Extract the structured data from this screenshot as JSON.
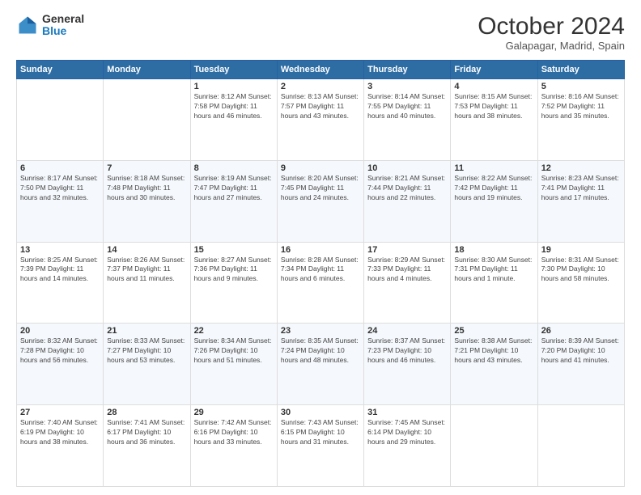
{
  "logo": {
    "general": "General",
    "blue": "Blue"
  },
  "header": {
    "month": "October 2024",
    "location": "Galapagar, Madrid, Spain"
  },
  "weekdays": [
    "Sunday",
    "Monday",
    "Tuesday",
    "Wednesday",
    "Thursday",
    "Friday",
    "Saturday"
  ],
  "weeks": [
    [
      {
        "day": "",
        "info": ""
      },
      {
        "day": "",
        "info": ""
      },
      {
        "day": "1",
        "info": "Sunrise: 8:12 AM\nSunset: 7:58 PM\nDaylight: 11 hours and 46 minutes."
      },
      {
        "day": "2",
        "info": "Sunrise: 8:13 AM\nSunset: 7:57 PM\nDaylight: 11 hours and 43 minutes."
      },
      {
        "day": "3",
        "info": "Sunrise: 8:14 AM\nSunset: 7:55 PM\nDaylight: 11 hours and 40 minutes."
      },
      {
        "day": "4",
        "info": "Sunrise: 8:15 AM\nSunset: 7:53 PM\nDaylight: 11 hours and 38 minutes."
      },
      {
        "day": "5",
        "info": "Sunrise: 8:16 AM\nSunset: 7:52 PM\nDaylight: 11 hours and 35 minutes."
      }
    ],
    [
      {
        "day": "6",
        "info": "Sunrise: 8:17 AM\nSunset: 7:50 PM\nDaylight: 11 hours and 32 minutes."
      },
      {
        "day": "7",
        "info": "Sunrise: 8:18 AM\nSunset: 7:48 PM\nDaylight: 11 hours and 30 minutes."
      },
      {
        "day": "8",
        "info": "Sunrise: 8:19 AM\nSunset: 7:47 PM\nDaylight: 11 hours and 27 minutes."
      },
      {
        "day": "9",
        "info": "Sunrise: 8:20 AM\nSunset: 7:45 PM\nDaylight: 11 hours and 24 minutes."
      },
      {
        "day": "10",
        "info": "Sunrise: 8:21 AM\nSunset: 7:44 PM\nDaylight: 11 hours and 22 minutes."
      },
      {
        "day": "11",
        "info": "Sunrise: 8:22 AM\nSunset: 7:42 PM\nDaylight: 11 hours and 19 minutes."
      },
      {
        "day": "12",
        "info": "Sunrise: 8:23 AM\nSunset: 7:41 PM\nDaylight: 11 hours and 17 minutes."
      }
    ],
    [
      {
        "day": "13",
        "info": "Sunrise: 8:25 AM\nSunset: 7:39 PM\nDaylight: 11 hours and 14 minutes."
      },
      {
        "day": "14",
        "info": "Sunrise: 8:26 AM\nSunset: 7:37 PM\nDaylight: 11 hours and 11 minutes."
      },
      {
        "day": "15",
        "info": "Sunrise: 8:27 AM\nSunset: 7:36 PM\nDaylight: 11 hours and 9 minutes."
      },
      {
        "day": "16",
        "info": "Sunrise: 8:28 AM\nSunset: 7:34 PM\nDaylight: 11 hours and 6 minutes."
      },
      {
        "day": "17",
        "info": "Sunrise: 8:29 AM\nSunset: 7:33 PM\nDaylight: 11 hours and 4 minutes."
      },
      {
        "day": "18",
        "info": "Sunrise: 8:30 AM\nSunset: 7:31 PM\nDaylight: 11 hours and 1 minute."
      },
      {
        "day": "19",
        "info": "Sunrise: 8:31 AM\nSunset: 7:30 PM\nDaylight: 10 hours and 58 minutes."
      }
    ],
    [
      {
        "day": "20",
        "info": "Sunrise: 8:32 AM\nSunset: 7:28 PM\nDaylight: 10 hours and 56 minutes."
      },
      {
        "day": "21",
        "info": "Sunrise: 8:33 AM\nSunset: 7:27 PM\nDaylight: 10 hours and 53 minutes."
      },
      {
        "day": "22",
        "info": "Sunrise: 8:34 AM\nSunset: 7:26 PM\nDaylight: 10 hours and 51 minutes."
      },
      {
        "day": "23",
        "info": "Sunrise: 8:35 AM\nSunset: 7:24 PM\nDaylight: 10 hours and 48 minutes."
      },
      {
        "day": "24",
        "info": "Sunrise: 8:37 AM\nSunset: 7:23 PM\nDaylight: 10 hours and 46 minutes."
      },
      {
        "day": "25",
        "info": "Sunrise: 8:38 AM\nSunset: 7:21 PM\nDaylight: 10 hours and 43 minutes."
      },
      {
        "day": "26",
        "info": "Sunrise: 8:39 AM\nSunset: 7:20 PM\nDaylight: 10 hours and 41 minutes."
      }
    ],
    [
      {
        "day": "27",
        "info": "Sunrise: 7:40 AM\nSunset: 6:19 PM\nDaylight: 10 hours and 38 minutes."
      },
      {
        "day": "28",
        "info": "Sunrise: 7:41 AM\nSunset: 6:17 PM\nDaylight: 10 hours and 36 minutes."
      },
      {
        "day": "29",
        "info": "Sunrise: 7:42 AM\nSunset: 6:16 PM\nDaylight: 10 hours and 33 minutes."
      },
      {
        "day": "30",
        "info": "Sunrise: 7:43 AM\nSunset: 6:15 PM\nDaylight: 10 hours and 31 minutes."
      },
      {
        "day": "31",
        "info": "Sunrise: 7:45 AM\nSunset: 6:14 PM\nDaylight: 10 hours and 29 minutes."
      },
      {
        "day": "",
        "info": ""
      },
      {
        "day": "",
        "info": ""
      }
    ]
  ]
}
